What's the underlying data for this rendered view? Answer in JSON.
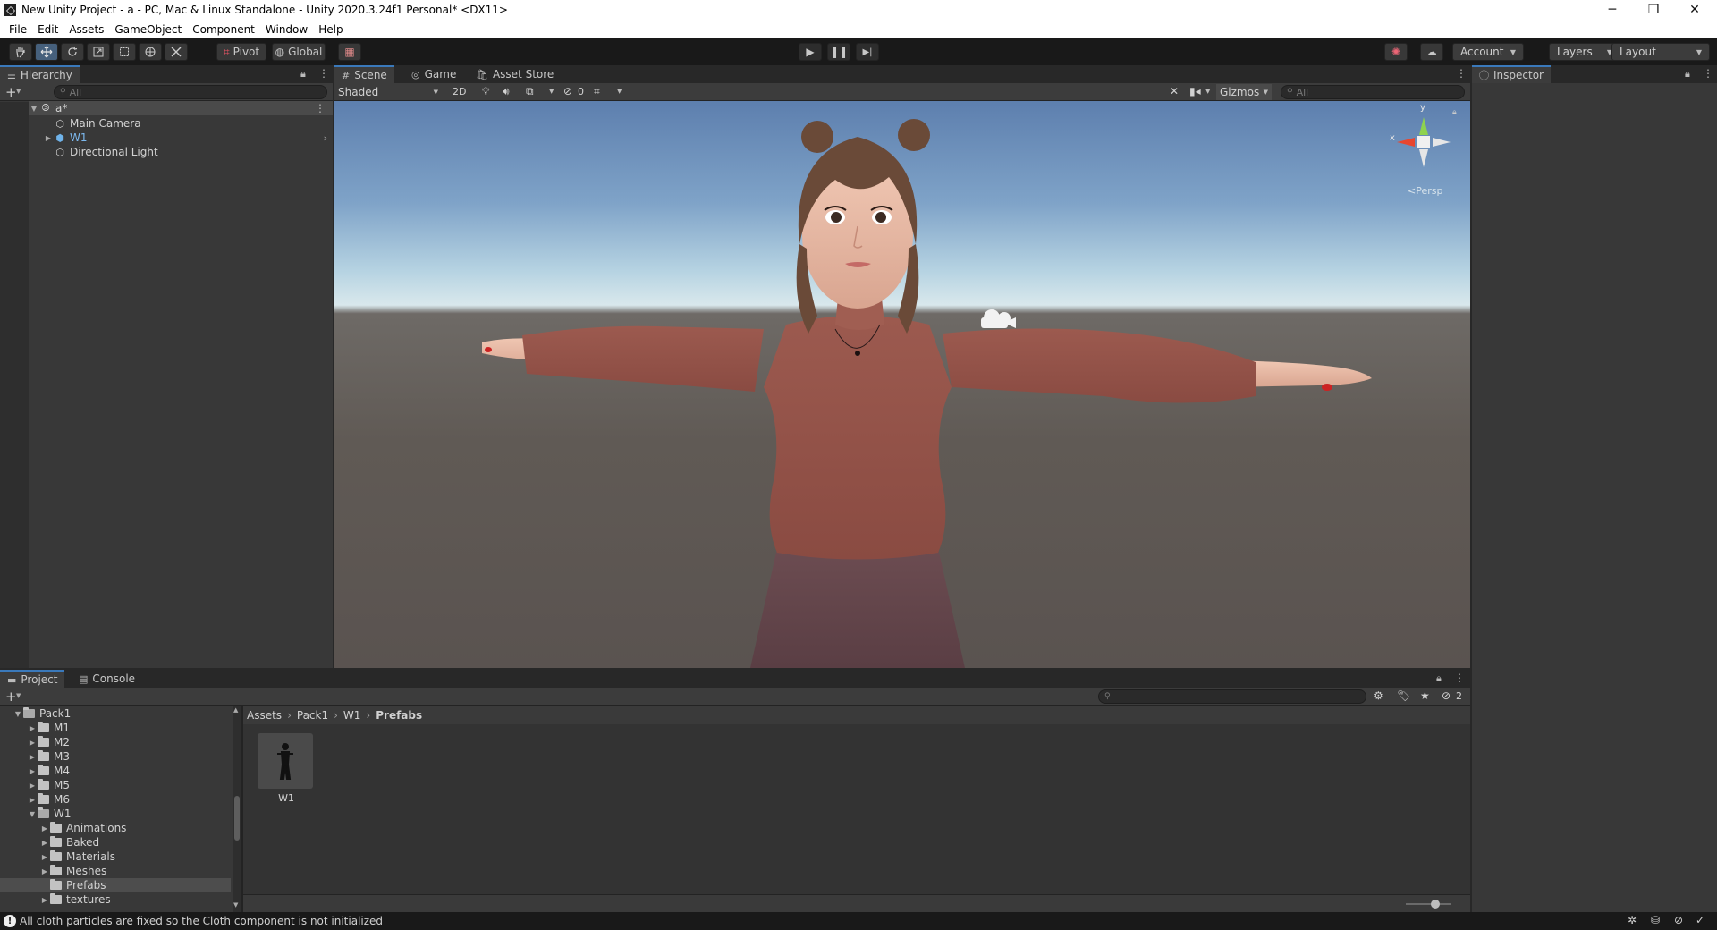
{
  "window": {
    "title": "New Unity Project - a - PC, Mac & Linux Standalone - Unity 2020.3.24f1 Personal* <DX11>",
    "minimize": "─",
    "restore": "❐",
    "close": "✕"
  },
  "menu": [
    "File",
    "Edit",
    "Assets",
    "GameObject",
    "Component",
    "Window",
    "Help"
  ],
  "toolbar": {
    "pivot_label": "Pivot",
    "global_label": "Global",
    "account_label": "Account",
    "layers_label": "Layers",
    "layout_label": "Layout"
  },
  "hierarchy": {
    "tab_label": "Hierarchy",
    "search_placeholder": "All",
    "scene_name": "a*",
    "items": [
      "Main Camera",
      "W1",
      "Directional Light"
    ]
  },
  "scene_view": {
    "tabs": [
      "Scene",
      "Game",
      "Asset Store"
    ],
    "shading_mode": "Shaded",
    "mode_2d": "2D",
    "hidden_count": "0",
    "gizmos_label": "Gizmos",
    "search_placeholder": "All",
    "projection_label": "Persp",
    "axis_y": "y",
    "axis_x": "x"
  },
  "inspector": {
    "tab_label": "Inspector"
  },
  "project": {
    "tabs": [
      "Project",
      "Console"
    ],
    "tree": {
      "root": "Pack1",
      "folders": [
        "M1",
        "M2",
        "M3",
        "M4",
        "M5",
        "M6"
      ],
      "open_folder": "W1",
      "subfolders": [
        "Animations",
        "Baked",
        "Materials",
        "Meshes",
        "Prefabs",
        "textures"
      ],
      "selected": "Prefabs"
    },
    "breadcrumb": [
      "Assets",
      "Pack1",
      "W1",
      "Prefabs"
    ],
    "assets": [
      {
        "name": "W1"
      }
    ],
    "hidden_count": "2"
  },
  "status": {
    "message": "All cloth particles are fixed so the Cloth component is not initialized"
  }
}
